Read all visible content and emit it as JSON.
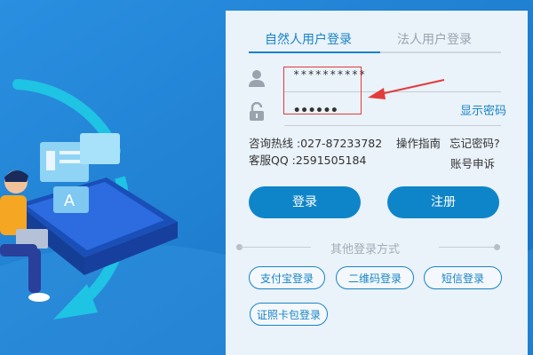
{
  "tabs": {
    "natural_person": "自然人用户登录",
    "legal_person": "法人用户登录"
  },
  "login": {
    "username_value": "**********",
    "password_value": "••••••",
    "show_password": "显示密码"
  },
  "contact": {
    "hotline": "咨询热线 :027-87233782",
    "qq": "客服QQ :2591505184"
  },
  "links": {
    "guide": "操作指南",
    "forgot": "忘记密码?",
    "appeal": "账号申诉"
  },
  "buttons": {
    "login": "登录",
    "register": "注册"
  },
  "other_login": {
    "title": "其他登录方式",
    "alipay": "支付宝登录",
    "qr": "二维码登录",
    "sms": "短信登录",
    "cert": "证照卡包登录"
  },
  "colors": {
    "accent": "#1784c7",
    "button": "#0f85c9",
    "background": "#1e82d4",
    "highlight": "#e23b3b"
  }
}
